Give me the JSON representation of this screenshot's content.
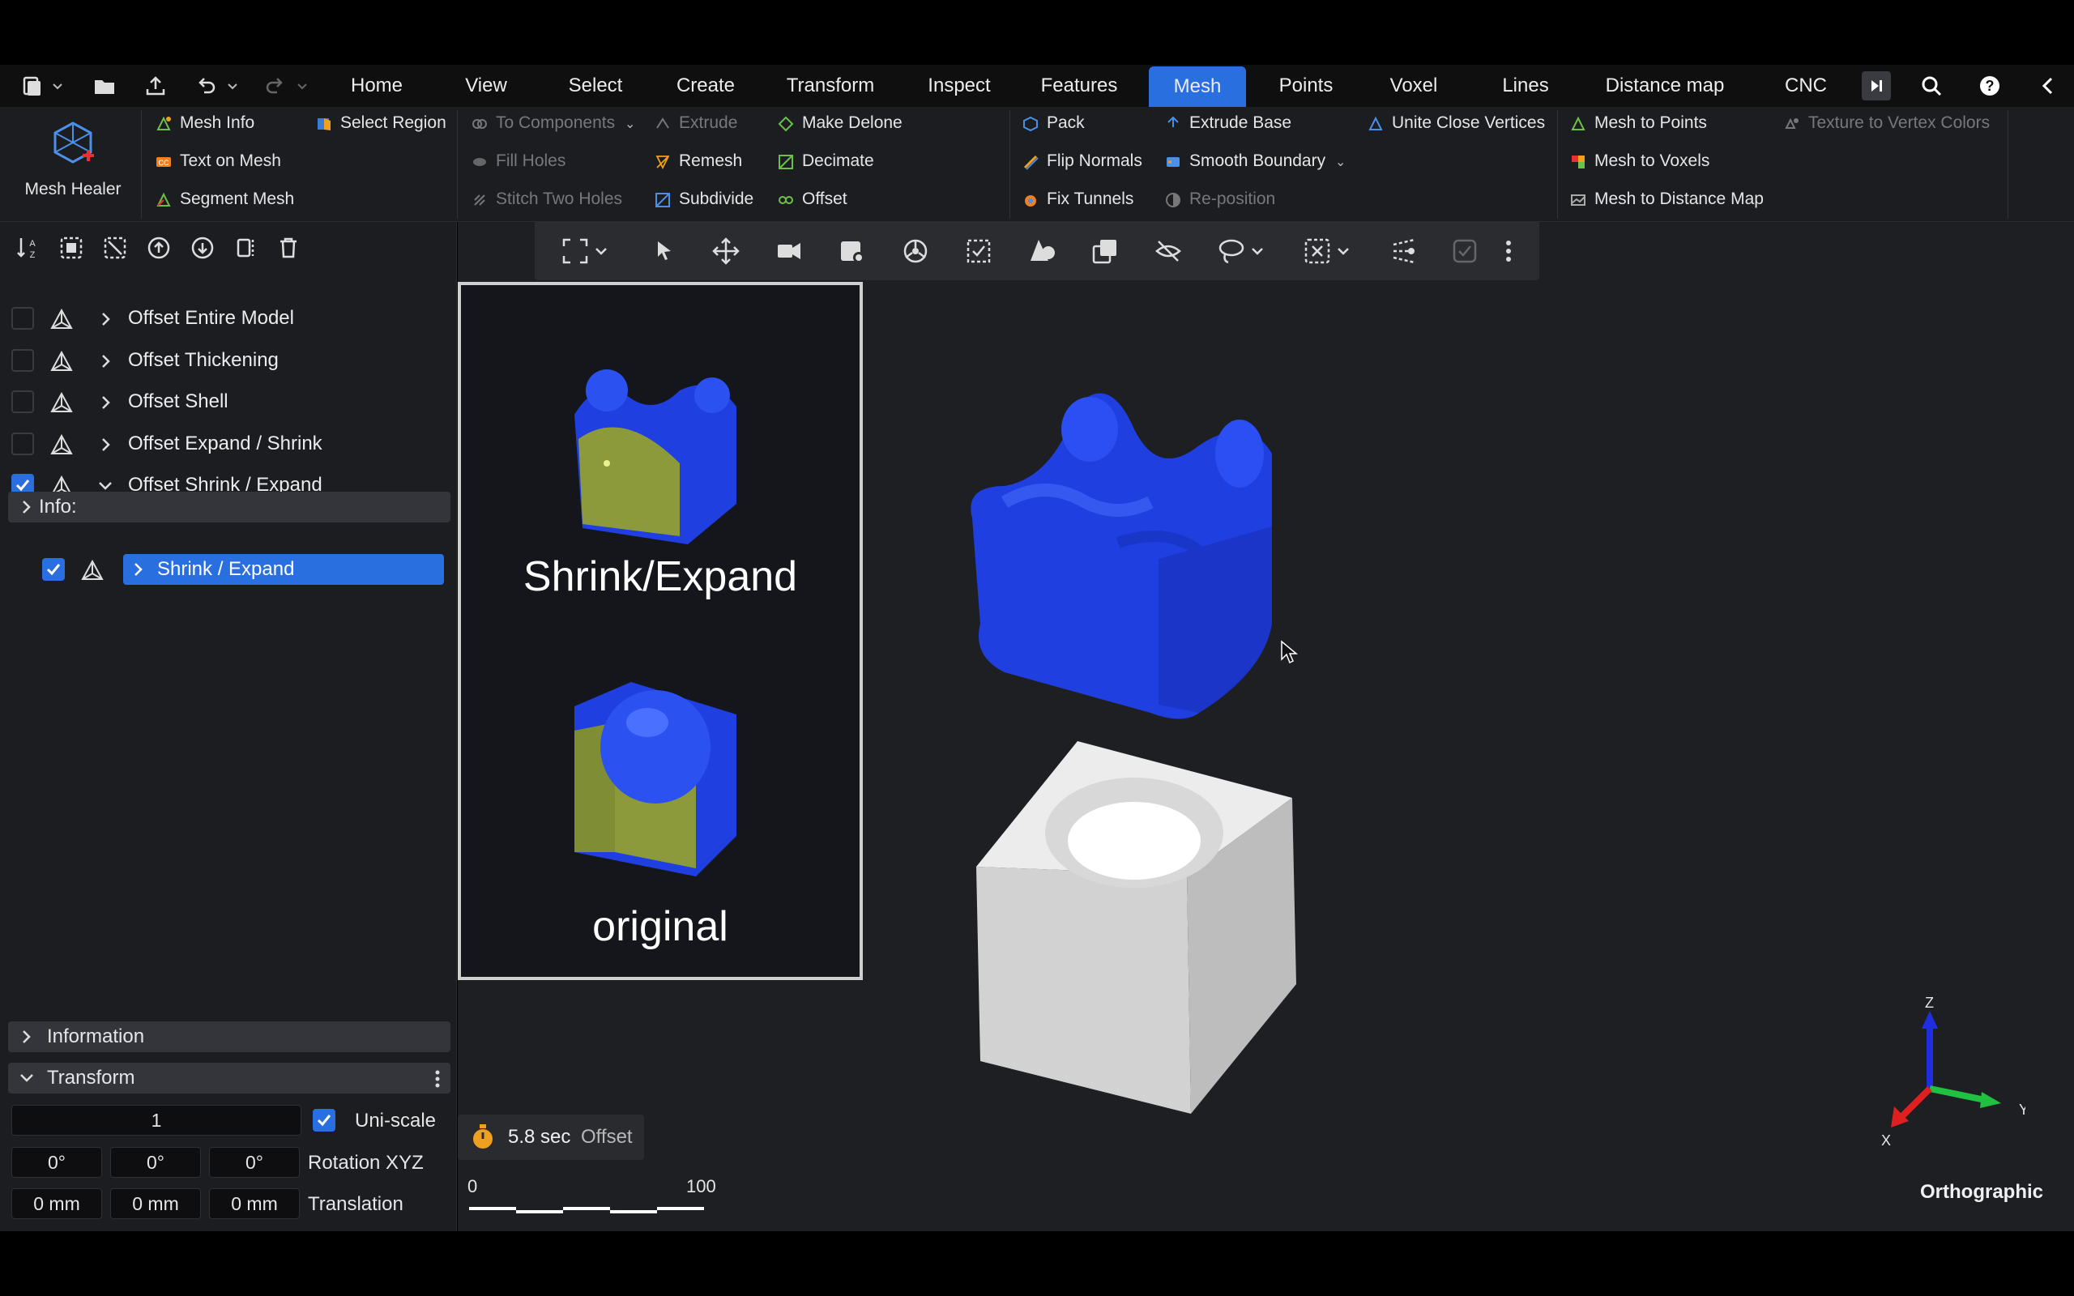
{
  "tabs": [
    "Home",
    "View",
    "Select",
    "Create",
    "Transform",
    "Inspect",
    "Features",
    "Mesh",
    "Points",
    "Voxel",
    "Lines",
    "Distance map",
    "CNC"
  ],
  "active_tab": "Mesh",
  "mesh_healer": {
    "label": "Mesh Healer"
  },
  "ribbon": {
    "mesh_info": "Mesh Info",
    "select_region": "Select Region",
    "text_on_mesh": "Text on Mesh",
    "segment_mesh": "Segment Mesh",
    "to_components": "To Components",
    "extrude": "Extrude",
    "make_delone": "Make Delone",
    "fill_holes": "Fill Holes",
    "remesh": "Remesh",
    "decimate": "Decimate",
    "stitch_two_holes": "Stitch Two Holes",
    "subdivide": "Subdivide",
    "offset": "Offset",
    "pack": "Pack",
    "extrude_base": "Extrude Base",
    "unite_close_vertices": "Unite Close Vertices",
    "flip_normals": "Flip Normals",
    "smooth_boundary": "Smooth Boundary",
    "fix_tunnels": "Fix Tunnels",
    "reposition": "Re-position",
    "mesh_to_points": "Mesh to Points",
    "texture_to_vertex_colors": "Texture to Vertex Colors",
    "mesh_to_voxels": "Mesh to Voxels",
    "mesh_to_distance_map": "Mesh to Distance Map"
  },
  "tree": {
    "items": [
      {
        "label": "Offset Entire Model",
        "checked": false
      },
      {
        "label": "Offset Thickening",
        "checked": false
      },
      {
        "label": "Offset Shell",
        "checked": false
      },
      {
        "label": "Offset Expand / Shrink",
        "checked": false
      },
      {
        "label": "Offset Shrink / Expand",
        "checked": true
      }
    ],
    "info_label": "Info:",
    "child_label": "Shrink / Expand"
  },
  "information": {
    "label": "Information"
  },
  "transform": {
    "label": "Transform",
    "scale_value": "1",
    "uniscale_label": "Uni-scale",
    "rotation": [
      "0°",
      "0°",
      "0°"
    ],
    "rotation_label": "Rotation XYZ",
    "translation": [
      "0 mm",
      "0 mm",
      "0 mm"
    ],
    "translation_label": "Translation"
  },
  "image_panel": {
    "top_caption": "Shrink/Expand",
    "bottom_caption": "original"
  },
  "timer": {
    "time": "5.8 sec",
    "operation": "Offset"
  },
  "scale_bar": {
    "min": "0",
    "max": "100"
  },
  "axes": {
    "z": "Z",
    "y": "Y",
    "x": "X"
  },
  "projection": "Orthographic",
  "colors": {
    "accent": "#2a6fe0",
    "model_blue": "#1f3fe0",
    "model_grey": "#d4d4d4",
    "olive": "#8a9a3a"
  }
}
